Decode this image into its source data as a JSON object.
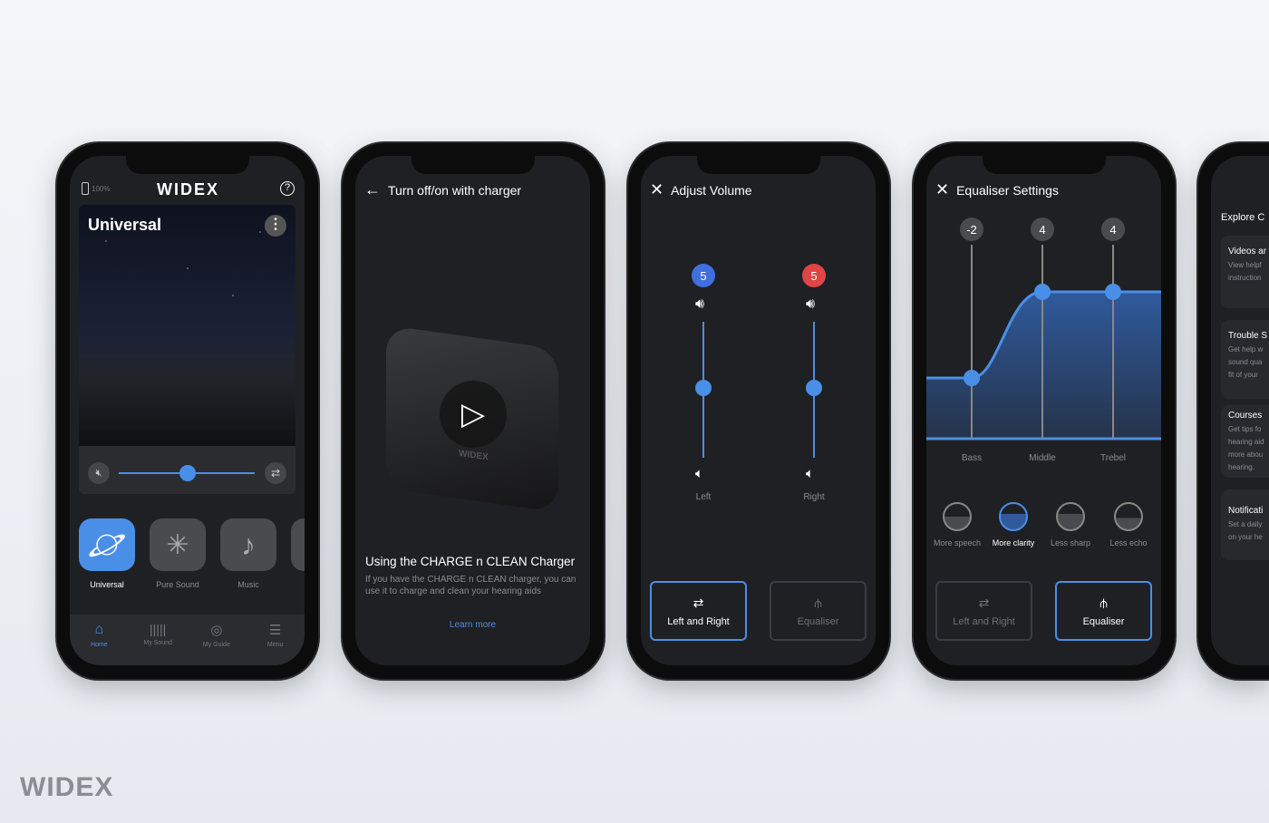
{
  "brand": "WIDEX",
  "home": {
    "battery": "100%",
    "program_title": "Universal",
    "programs": [
      {
        "label": "Universal",
        "active": true
      },
      {
        "label": "Pure Sound"
      },
      {
        "label": "Music"
      }
    ],
    "volume_level": 0.5,
    "nav": [
      {
        "label": "Home",
        "active": true
      },
      {
        "label": "My Sound"
      },
      {
        "label": "My Guide"
      },
      {
        "label": "Menu"
      }
    ]
  },
  "charger": {
    "header": "Turn off/on with charger",
    "title": "Using the CHARGE n CLEAN Charger",
    "description": "If you have the CHARGE n CLEAN charger, you can use it to charge and clean your hearing aids",
    "link": "Learn more",
    "device_logo": "WIDEX"
  },
  "volume": {
    "header": "Adjust Volume",
    "left": {
      "label": "Left",
      "value": "5",
      "color": "#3f6fe0"
    },
    "right": {
      "label": "Right",
      "value": "5",
      "color": "#e04545"
    },
    "buttons": [
      "Left and Right",
      "Equaliser"
    ]
  },
  "equaliser": {
    "header": "Equaliser Settings",
    "bands": [
      {
        "label": "Bass",
        "value": "-2"
      },
      {
        "label": "Middle",
        "value": "4"
      },
      {
        "label": "Trebel",
        "value": "4"
      }
    ],
    "presets": [
      "More speech",
      "More clarity",
      "Less sharp",
      "Less echo"
    ],
    "active_preset": "More clarity",
    "buttons": [
      "Left and Right",
      "Equaliser"
    ]
  },
  "explore": {
    "title": "Explore C",
    "cards": [
      {
        "title": "Videos ar",
        "lines": [
          "View helpf",
          "instruction"
        ]
      },
      {
        "title": "Trouble S",
        "lines": [
          "Get help w",
          "sound qua",
          "fit of your"
        ]
      },
      {
        "title": "Courses",
        "lines": [
          "Get tips fo",
          "hearing aid",
          "more abou",
          "hearing."
        ]
      },
      {
        "title": "Notificati",
        "lines": [
          "Set a daily",
          "on your he"
        ]
      }
    ]
  },
  "accent": "#4a8fe7"
}
